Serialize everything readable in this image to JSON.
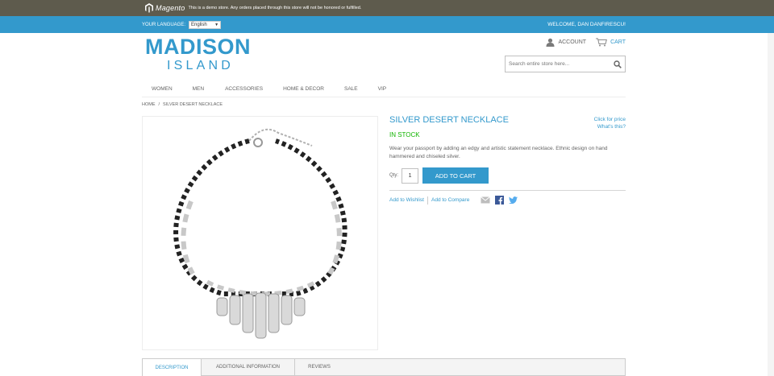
{
  "demo_bar": {
    "brand": "Magento",
    "notice": "This is a demo store. Any orders placed through this store will not be honored or fulfilled."
  },
  "header": {
    "language_label": "YOUR LANGUAGE:",
    "language_value": "English",
    "welcome": "WELCOME, DAN DANFIRESCU!"
  },
  "logo": {
    "main": "MADISON",
    "sub": "ISLAND"
  },
  "account": {
    "account_label": "ACCOUNT",
    "cart_label": "CART"
  },
  "search": {
    "placeholder": "Search entire store here..."
  },
  "nav": {
    "items": [
      "WOMEN",
      "MEN",
      "ACCESSORIES",
      "HOME & DECOR",
      "SALE",
      "VIP"
    ]
  },
  "breadcrumb": {
    "home": "HOME",
    "separator": "/",
    "current": "SILVER DESERT NECKLACE"
  },
  "product": {
    "name": "SILVER DESERT NECKLACE",
    "stock": "IN STOCK",
    "description": "Wear your passport by adding an edgy and artistic statement necklace. Ethnic design on hand hammered and chiseled silver.",
    "click_for_price": "Click for price",
    "whats_this": "What's this?",
    "qty_label": "Qty:",
    "qty_value": "1",
    "add_to_cart": "ADD TO CART",
    "add_to_wishlist": "Add to Wishlist",
    "add_to_compare": "Add to Compare"
  },
  "tabs": [
    "DESCRIPTION",
    "ADDITIONAL INFORMATION",
    "REVIEWS"
  ],
  "colors": {
    "accent": "#3399cc",
    "demo_bar": "#5e5b4d",
    "in_stock": "#11b400"
  }
}
